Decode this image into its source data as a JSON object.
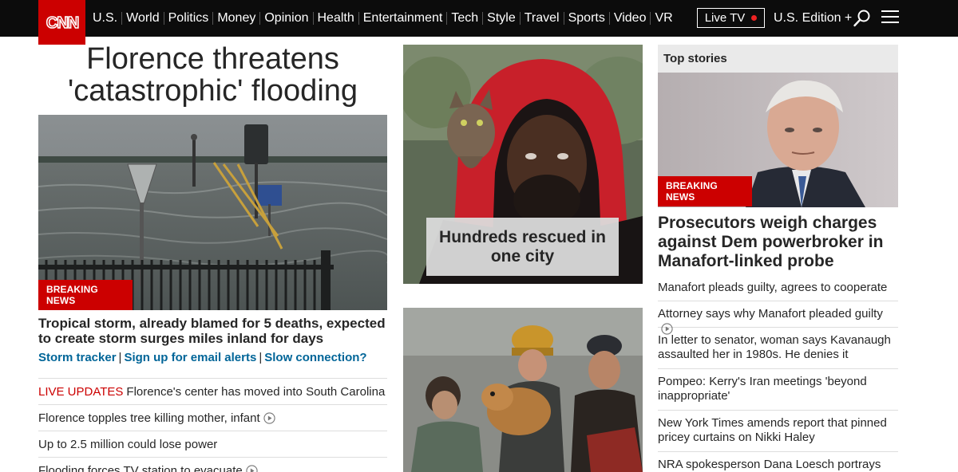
{
  "nav": {
    "logo": "CNN",
    "links": [
      "U.S.",
      "World",
      "Politics",
      "Money",
      "Opinion",
      "Health",
      "Entertainment",
      "Tech",
      "Style",
      "Travel",
      "Sports",
      "Video",
      "VR"
    ],
    "live_tv": "Live TV",
    "edition": "U.S. Edition +"
  },
  "lead": {
    "headline": "Florence threatens 'catastrophic' flooding",
    "badge": "BREAKING NEWS",
    "story_title": "Tropical storm, already blamed for 5 deaths, expected to create storm surges miles inland for days",
    "links": [
      "Storm tracker",
      "Sign up for email alerts",
      "Slow connection?"
    ],
    "items": [
      {
        "prefix": "LIVE UPDATES",
        "text": "Florence's center has moved into South Carolina",
        "video": false
      },
      {
        "prefix": "",
        "text": "Florence topples tree killing mother, infant",
        "video": true
      },
      {
        "prefix": "",
        "text": "Up to 2.5 million could lose power",
        "video": false
      },
      {
        "prefix": "",
        "text": "Flooding forces TV station to evacuate",
        "video": true
      }
    ]
  },
  "middle": {
    "caption": "Hundreds rescued in one city"
  },
  "top_stories": {
    "header": "Top stories",
    "badge": "BREAKING NEWS",
    "title": "Prosecutors weigh charges against Dem powerbroker in Manafort-linked probe",
    "items": [
      {
        "text": "Manafort pleads guilty, agrees to cooperate",
        "video": false
      },
      {
        "text": "Attorney says why Manafort pleaded guilty",
        "video": true
      },
      {
        "text": "In letter to senator, woman says Kavanaugh assaulted her in 1980s. He denies it",
        "video": false
      },
      {
        "text": "Pompeo: Kerry's Iran meetings 'beyond inappropriate'",
        "video": false
      },
      {
        "text": "New York Times amends report that pinned pricey curtains on Nikki Haley",
        "video": false
      },
      {
        "text": "NRA spokesperson Dana Loesch portrays",
        "video": false
      }
    ]
  },
  "colors": {
    "brand_red": "#cc0000",
    "nav_bg": "#0c0c0c",
    "link_blue": "#006598"
  }
}
